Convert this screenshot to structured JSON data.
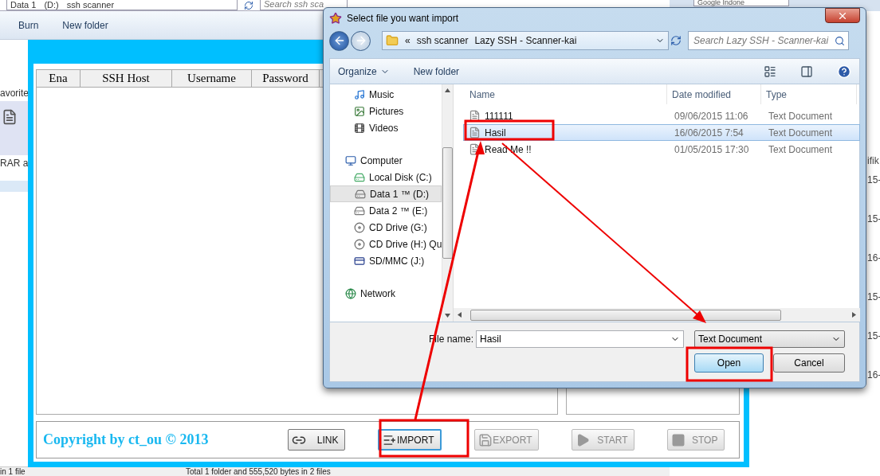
{
  "explorer": {
    "address": [
      "Data 1",
      "(D:)",
      "ssh scanner"
    ],
    "search_placeholder": "Search ssh sca",
    "toolbar": [
      "Burn",
      "New folder"
    ],
    "sidebar_fragments": [
      "avorite",
      "RAR a"
    ],
    "status_bar": [
      "in 1 file",
      "Total 1 folder and 555,520 bytes in 2 files"
    ]
  },
  "browser": {
    "search_placeholder": "Google Indone",
    "fragments": [
      "ifik",
      "15-",
      "15-",
      "16-",
      "15-",
      "15-",
      "16-"
    ]
  },
  "app": {
    "columns": [
      "Ena",
      "SSH Host",
      "Username",
      "Password"
    ],
    "copyright": "Copyright by ct_ou © 2013",
    "buttons": [
      {
        "label": "LINK",
        "kind": "link",
        "disabled": false,
        "focused": false
      },
      {
        "label": "IMPORT",
        "kind": "import",
        "disabled": false,
        "focused": true
      },
      {
        "label": "EXPORT",
        "kind": "export",
        "disabled": true,
        "focused": false
      },
      {
        "label": "START",
        "kind": "start",
        "disabled": true,
        "focused": false
      },
      {
        "label": "STOP",
        "kind": "stop",
        "disabled": true,
        "focused": false
      }
    ]
  },
  "dialog": {
    "title": "Select file you want import",
    "breadcrumb": [
      "«",
      "ssh scanner",
      "Lazy SSH - Scanner-kai"
    ],
    "search_placeholder": "Search Lazy SSH - Scanner-kai",
    "toolbar": [
      "Organize",
      "New folder"
    ],
    "nav_pane": [
      {
        "label": "Music",
        "kind": "music",
        "selected": false
      },
      {
        "label": "Pictures",
        "kind": "pictures",
        "selected": false
      },
      {
        "label": "Videos",
        "kind": "videos",
        "selected": false
      },
      {
        "label": "Computer",
        "kind": "computer",
        "selected": false,
        "children": [
          {
            "label": "Local Disk (C:)",
            "kind": "disk",
            "selected": false
          },
          {
            "label": "Data 1 ™ (D:)",
            "kind": "drive",
            "selected": true
          },
          {
            "label": "Data 2 ™ (E:)",
            "kind": "drive",
            "selected": false
          },
          {
            "label": "CD Drive (G:)",
            "kind": "cd",
            "selected": false
          },
          {
            "label": "CD Drive (H:) Qu",
            "kind": "cd",
            "selected": false
          },
          {
            "label": "SD/MMC (J:)",
            "kind": "sd",
            "selected": false
          }
        ]
      },
      {
        "label": "Network",
        "kind": "network",
        "selected": false
      }
    ],
    "columns": [
      "Name",
      "Date modified",
      "Type"
    ],
    "files": [
      {
        "name": "111111",
        "date": "09/06/2015 11:06",
        "type": "Text Document",
        "selected": false
      },
      {
        "name": "Hasil",
        "date": "16/06/2015 7:54",
        "type": "Text Document",
        "selected": true
      },
      {
        "name": "Read Me !!",
        "date": "01/05/2015 17:30",
        "type": "Text Document",
        "selected": false
      }
    ],
    "file_name_label": "File name:",
    "file_name": "Hasil",
    "file_type": "Text Document",
    "buttons": [
      {
        "label": "Open",
        "default": true
      },
      {
        "label": "Cancel",
        "default": false
      }
    ]
  }
}
